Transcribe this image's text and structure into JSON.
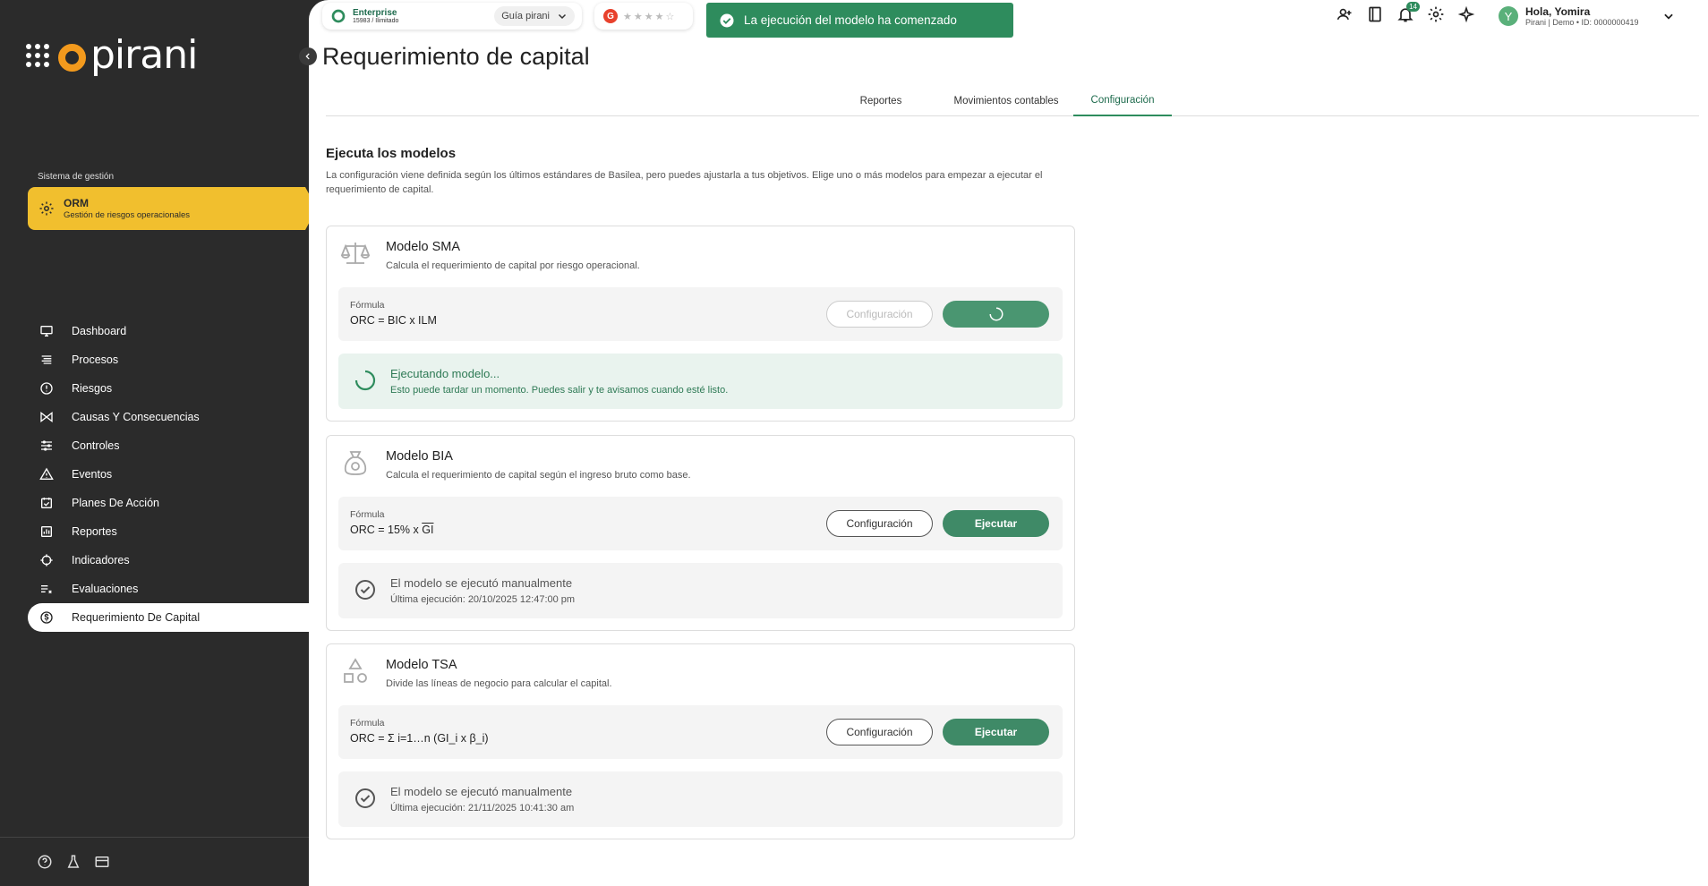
{
  "sidebar": {
    "brand": "pirani",
    "section_label": "Sistema de gestión",
    "module": {
      "title": "ORM",
      "subtitle": "Gestión de riesgos operacionales"
    },
    "items": [
      {
        "label": "Dashboard",
        "icon": "monitor-icon"
      },
      {
        "label": "Procesos",
        "icon": "list-icon"
      },
      {
        "label": "Riesgos",
        "icon": "alert-circle-icon"
      },
      {
        "label": "Causas Y Consecuencias",
        "icon": "bowtie-icon"
      },
      {
        "label": "Controles",
        "icon": "sliders-icon"
      },
      {
        "label": "Eventos",
        "icon": "warning-icon"
      },
      {
        "label": "Planes De Acción",
        "icon": "calendar-check-icon"
      },
      {
        "label": "Reportes",
        "icon": "chart-icon"
      },
      {
        "label": "Indicadores",
        "icon": "target-icon"
      },
      {
        "label": "Evaluaciones",
        "icon": "checklist-icon"
      },
      {
        "label": "Requerimiento De Capital",
        "icon": "dollar-icon",
        "active": true
      }
    ],
    "bottom_icons": [
      "help-icon",
      "flask-icon",
      "card-icon"
    ]
  },
  "topbar": {
    "plan_title": "Enterprise",
    "plan_sub": "15983 / Ilimitado",
    "guide_label": "Guía pirani",
    "rating_logo": "G",
    "stars": "★★★★☆",
    "notification_count": "14",
    "user_greeting": "Hola, Yomira",
    "user_sub": "Pirani | Demo • ID: 0000000419",
    "avatar_letter": "Y"
  },
  "toast": {
    "message": "La ejecución del modelo ha comenzado",
    "color": "#2e8c5d"
  },
  "page": {
    "title": "Requerimiento de capital",
    "tabs": [
      {
        "label": "Reportes"
      },
      {
        "label": "Movimientos contables"
      },
      {
        "label": "Configuración",
        "active": true
      }
    ],
    "section_title": "Ejecuta los modelos",
    "section_desc": "La configuración viene definida según los últimos estándares de Basilea, pero puedes ajustarla a tus objetivos. Elige uno o más modelos para empezar a ejecutar el requerimiento de capital."
  },
  "models": [
    {
      "title": "Modelo SMA",
      "desc": "Calcula el requerimiento de capital por riesgo operacional.",
      "icon": "scale-icon",
      "formula_label": "Fórmula",
      "formula": "ORC = BIC x ILM",
      "config_label": "Configuración",
      "run_label": "",
      "status_title": "Ejecutando modelo...",
      "status_sub": "Esto puede tardar un momento. Puedes salir y te avisamos cuando esté listo."
    },
    {
      "title": "Modelo BIA",
      "desc": "Calcula el requerimiento de capital según el ingreso bruto como base.",
      "icon": "moneybag-icon",
      "formula_label": "Fórmula",
      "formula_prefix": "ORC = 15% x ",
      "formula_overline": "GI",
      "config_label": "Configuración",
      "run_label": "Ejecutar",
      "status_title": "El modelo se ejecutó manualmente",
      "status_sub": "Última ejecución: 20/10/2025 12:47:00 pm"
    },
    {
      "title": "Modelo TSA",
      "desc": "Divide las líneas de negocio para calcular el capital.",
      "icon": "shapes-icon",
      "formula_label": "Fórmula",
      "formula": "ORC = Σ i=1…n (GI_i x β_i)",
      "config_label": "Configuración",
      "run_label": "Ejecutar",
      "status_title": "El modelo se ejecutó manualmente",
      "status_sub": "Última ejecución: 21/11/2025 10:41:30 am"
    }
  ]
}
